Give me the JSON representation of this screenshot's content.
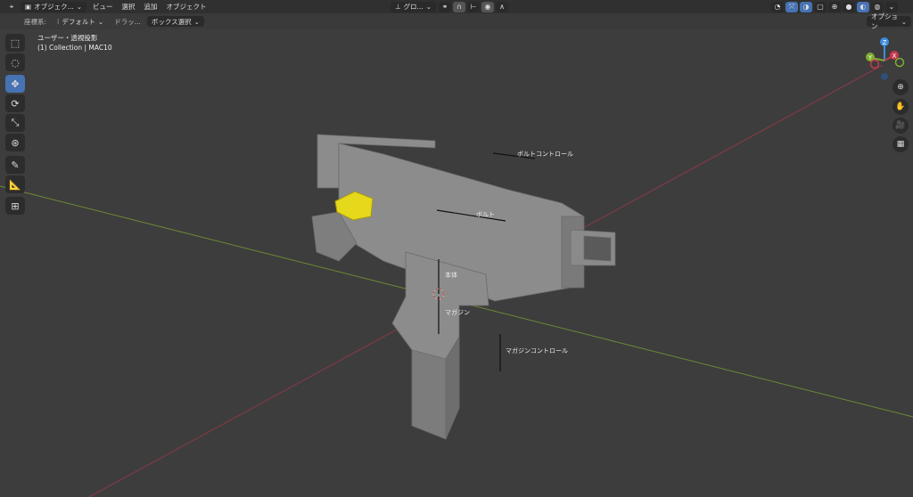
{
  "header": {
    "editor_icon": "editor-type-icon",
    "mode": "オブジェク...",
    "menus": [
      "ビュー",
      "選択",
      "追加",
      "オブジェクト"
    ],
    "transform_orientation": "グロ...",
    "options": "オプション"
  },
  "toolbar2": {
    "coord_label": "座標系:",
    "coord_value": "デフォルト",
    "drag_label": "ドラッ...",
    "select_mode": "ボックス選択"
  },
  "overlay": {
    "view_name": "ユーザー・透視投影",
    "collection": "(1) Collection | MAC10"
  },
  "gizmo": {
    "x": "X",
    "y": "Y",
    "z": "Z"
  },
  "bone_labels": {
    "bolt_control": "ボルトコントロール",
    "bolt": "ボルト",
    "body": "本体",
    "magazine": "マガジン",
    "magazine_control": "マガジンコントロール"
  },
  "colors": {
    "accent": "#4772b3",
    "x_axis": "#c7394e",
    "y_axis": "#7fad2f",
    "z_axis": "#3b8ee0",
    "selected": "#e0d515"
  }
}
